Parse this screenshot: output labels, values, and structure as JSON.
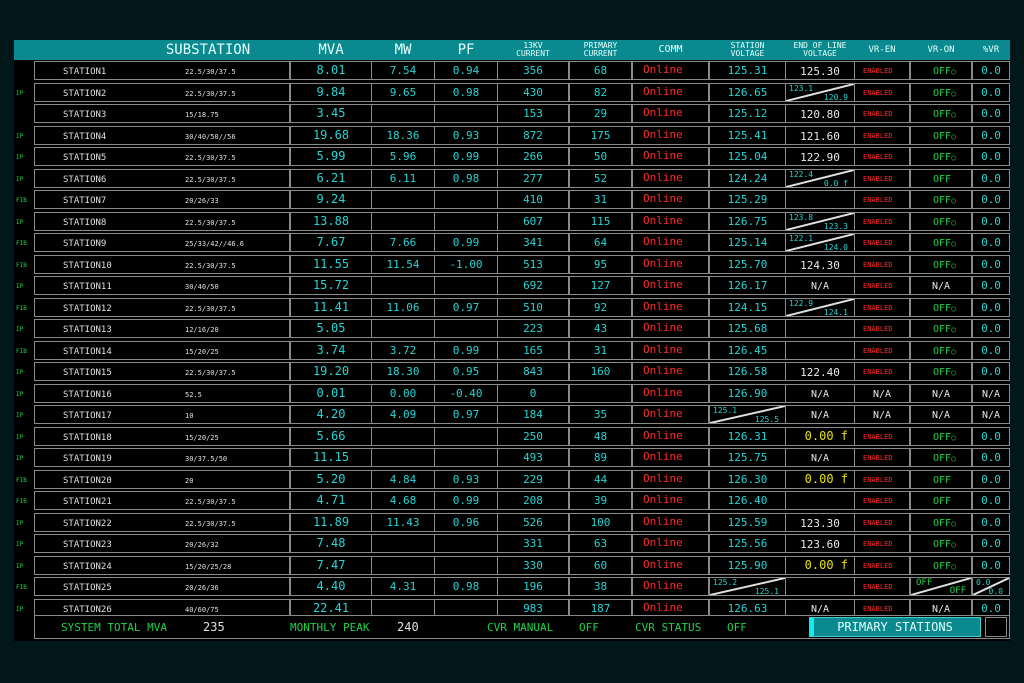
{
  "headers": {
    "substation": "SUBSTATION",
    "mva": "MVA",
    "mw": "MW",
    "pf": "PF",
    "kv_current": [
      "13KV",
      "CURRENT"
    ],
    "primary_current": [
      "PRIMARY",
      "CURRENT"
    ],
    "comm": "COMM",
    "station_voltage": [
      "STATION",
      "VOLTAGE"
    ],
    "eol_voltage": [
      "END OF LINE",
      "VOLTAGE"
    ],
    "vr_en": "VR-EN",
    "vr_on": "VR-ON",
    "pvr": "%VR"
  },
  "stations": [
    {
      "side": "",
      "name": "STATION1",
      "rating": "22.5/30/37.5",
      "mva": "8.01",
      "mw": "7.54",
      "pf": "0.94",
      "kv": "356",
      "pc": "68",
      "comm": "Online",
      "sv": {
        "v": "125.31"
      },
      "eol": {
        "v": "125.30"
      },
      "en": "ENABLED",
      "on": {
        "t": "OFF",
        "dot": true
      },
      "vr": "0.0"
    },
    {
      "side": "IP",
      "name": "STATION2",
      "rating": "22.5/30/37.5",
      "mva": "9.84",
      "mw": "9.65",
      "pf": "0.98",
      "kv": "430",
      "pc": "82",
      "comm": "Online",
      "sv": {
        "v": "126.65"
      },
      "eol": {
        "a": "123.1",
        "b": "120.9"
      },
      "en": "ENABLED",
      "on": {
        "t": "OFF",
        "dot": true
      },
      "vr": "0.0"
    },
    {
      "side": "",
      "name": "STATION3",
      "rating": "15/18.75",
      "mva": "3.45",
      "mw": "",
      "pf": "",
      "kv": "153",
      "pc": "29",
      "comm": "Online",
      "sv": {
        "v": "125.12"
      },
      "eol": {
        "v": "120.80"
      },
      "en": "ENABLED",
      "on": {
        "t": "OFF",
        "dot": true
      },
      "vr": "0.0"
    },
    {
      "side": "IP",
      "name": "STATION4",
      "rating": "30/40/50//56",
      "mva": "19.68",
      "mw": "18.36",
      "pf": "0.93",
      "kv": "872",
      "pc": "175",
      "comm": "Online",
      "sv": {
        "v": "125.41"
      },
      "eol": {
        "v": "121.60"
      },
      "en": "ENABLED",
      "on": {
        "t": "OFF",
        "dot": true
      },
      "vr": "0.0"
    },
    {
      "side": "IP",
      "name": "STATION5",
      "rating": "22.5/30/37.5",
      "mva": "5.99",
      "mw": "5.96",
      "pf": "0.99",
      "kv": "266",
      "pc": "50",
      "comm": "Online",
      "sv": {
        "v": "125.04"
      },
      "eol": {
        "v": "122.90"
      },
      "en": "ENABLED",
      "on": {
        "t": "OFF",
        "dot": true
      },
      "vr": "0.0"
    },
    {
      "side": "IP",
      "name": "STATION6",
      "rating": "22.5/30/37.5",
      "mva": "6.21",
      "mw": "6.11",
      "pf": "0.98",
      "kv": "277",
      "pc": "52",
      "comm": "Online",
      "sv": {
        "v": "124.24"
      },
      "eol": {
        "a": "122.4",
        "b": "0.0 f"
      },
      "en": "ENABLED",
      "on": {
        "t": "OFF",
        "dot": false
      },
      "vr": "0.0"
    },
    {
      "side": "FIB",
      "name": "STATION7",
      "rating": "20/26/33",
      "mva": "9.24",
      "mw": "",
      "pf": "",
      "kv": "410",
      "pc": "31",
      "comm": "Online",
      "sv": {
        "v": "125.29"
      },
      "eol": {},
      "en": "ENABLED",
      "on": {
        "t": "OFF",
        "dot": true
      },
      "vr": "0.0"
    },
    {
      "side": "IP",
      "name": "STATION8",
      "rating": "22.5/30/37.5",
      "mva": "13.88",
      "mw": "",
      "pf": "",
      "kv": "607",
      "pc": "115",
      "comm": "Online",
      "sv": {
        "v": "126.75"
      },
      "eol": {
        "a": "123.8",
        "b": "123.3"
      },
      "en": "ENABLED",
      "on": {
        "t": "OFF",
        "dot": true
      },
      "vr": "0.0"
    },
    {
      "side": "FIB",
      "name": "STATION9",
      "rating": "25/33/42//46.6",
      "mva": "7.67",
      "mw": "7.66",
      "pf": "0.99",
      "kv": "341",
      "pc": "64",
      "comm": "Online",
      "sv": {
        "v": "125.14"
      },
      "eol": {
        "a": "122.1",
        "b": "124.0"
      },
      "en": "ENABLED",
      "on": {
        "t": "OFF",
        "dot": true
      },
      "vr": "0.0"
    },
    {
      "side": "FIB",
      "name": "STATION10",
      "rating": "22.5/30/37.5",
      "mva": "11.55",
      "mw": "11.54",
      "pf": "-1.00",
      "kv": "513",
      "pc": "95",
      "comm": "Online",
      "sv": {
        "v": "125.70"
      },
      "eol": {
        "v": "124.30"
      },
      "en": "ENABLED",
      "on": {
        "t": "OFF",
        "dot": true
      },
      "vr": "0.0"
    },
    {
      "side": "IP",
      "name": "STATION11",
      "rating": "30/40/50",
      "mva": "15.72",
      "mw": "",
      "pf": "",
      "kv": "692",
      "pc": "127",
      "comm": "Online",
      "sv": {
        "v": "126.17"
      },
      "eol": {
        "na": "N/A"
      },
      "en": "ENABLED",
      "on": {
        "na": "N/A"
      },
      "vr": "0.0"
    },
    {
      "side": "FIB",
      "name": "STATION12",
      "rating": "22.5/30/37.5",
      "mva": "11.41",
      "mw": "11.06",
      "pf": "0.97",
      "kv": "510",
      "pc": "92",
      "comm": "Online",
      "sv": {
        "v": "124.15"
      },
      "eol": {
        "a": "122.9",
        "b": "124.1"
      },
      "en": "ENABLED",
      "on": {
        "t": "OFF",
        "dot": true
      },
      "vr": "0.0"
    },
    {
      "side": "IP",
      "name": "STATION13",
      "rating": "12/16/20",
      "mva": "5.05",
      "mw": "",
      "pf": "",
      "kv": "223",
      "pc": "43",
      "comm": "Online",
      "sv": {
        "v": "125.68"
      },
      "eol": {},
      "en": "ENABLED",
      "on": {
        "t": "OFF",
        "dot": true
      },
      "vr": "0.0"
    },
    {
      "side": "FIB",
      "name": "STATION14",
      "rating": "15/20/25",
      "mva": "3.74",
      "mw": "3.72",
      "pf": "0.99",
      "kv": "165",
      "pc": "31",
      "comm": "Online",
      "sv": {
        "v": "126.45"
      },
      "eol": {},
      "en": "ENABLED",
      "on": {
        "t": "OFF",
        "dot": true
      },
      "vr": "0.0"
    },
    {
      "side": "IP",
      "name": "STATION15",
      "rating": "22.5/30/37.5",
      "mva": "19.20",
      "mw": "18.30",
      "pf": "0.95",
      "kv": "843",
      "pc": "160",
      "comm": "Online",
      "sv": {
        "v": "126.58"
      },
      "eol": {
        "v": "122.40"
      },
      "en": "ENABLED",
      "on": {
        "t": "OFF",
        "dot": true
      },
      "vr": "0.0"
    },
    {
      "side": "IP",
      "name": "STATION16",
      "rating": "52.5",
      "mva": "0.01",
      "mw": "0.00",
      "pf": "-0.40",
      "kv": "0",
      "pc": "",
      "comm": "Online",
      "sv": {
        "v": "126.90"
      },
      "eol": {
        "na": "N/A"
      },
      "en_na": "N/A",
      "on": {
        "na": "N/A"
      },
      "vr_na": "N/A"
    },
    {
      "side": "IP",
      "name": "STATION17",
      "rating": "10",
      "mva": "4.20",
      "mw": "4.09",
      "pf": "0.97",
      "kv": "184",
      "pc": "35",
      "comm": "Online",
      "sv": {
        "a": "125.1",
        "b": "125.5"
      },
      "eol": {
        "na": "N/A"
      },
      "en_na": "N/A",
      "on": {
        "na": "N/A"
      },
      "vr_na": "N/A"
    },
    {
      "side": "IP",
      "name": "STATION18",
      "rating": "15/20/25",
      "mva": "5.66",
      "mw": "",
      "pf": "",
      "kv": "250",
      "pc": "48",
      "comm": "Online",
      "sv": {
        "v": "126.31"
      },
      "eol": {
        "y": "0.00 f"
      },
      "en": "ENABLED",
      "on": {
        "t": "OFF",
        "dot": true
      },
      "vr": "0.0"
    },
    {
      "side": "IP",
      "name": "STATION19",
      "rating": "30/37.5/50",
      "mva": "11.15",
      "mw": "",
      "pf": "",
      "kv": "493",
      "pc": "89",
      "comm": "Online",
      "sv": {
        "v": "125.75"
      },
      "eol": {
        "na": "N/A"
      },
      "en": "ENABLED",
      "on": {
        "t": "OFF",
        "dot": true
      },
      "vr": "0.0"
    },
    {
      "side": "FIB",
      "name": "STATION20",
      "rating": "20",
      "mva": "5.20",
      "mw": "4.84",
      "pf": "0.93",
      "kv": "229",
      "pc": "44",
      "comm": "Online",
      "sv": {
        "v": "126.30"
      },
      "eol": {
        "y": "0.00 f"
      },
      "en": "ENABLED",
      "on": {
        "t": "OFF",
        "dot": false
      },
      "vr": "0.0"
    },
    {
      "side": "FIB",
      "name": "STATION21",
      "rating": "22.5/30/37.5",
      "mva": "4.71",
      "mw": "4.68",
      "pf": "0.99",
      "kv": "208",
      "pc": "39",
      "comm": "Online",
      "sv": {
        "v": "126.40"
      },
      "eol": {},
      "en": "ENABLED",
      "on": {
        "t": "OFF",
        "dot": false
      },
      "vr": "0.0"
    },
    {
      "side": "IP",
      "name": "STATION22",
      "rating": "22.5/30/37.5",
      "mva": "11.89",
      "mw": "11.43",
      "pf": "0.96",
      "kv": "526",
      "pc": "100",
      "comm": "Online",
      "sv": {
        "v": "125.59"
      },
      "eol": {
        "v": "123.30"
      },
      "en": "ENABLED",
      "on": {
        "t": "OFF",
        "dot": true
      },
      "vr": "0.0"
    },
    {
      "side": "IP",
      "name": "STATION23",
      "rating": "20/26/32",
      "mva": "7.48",
      "mw": "",
      "pf": "",
      "kv": "331",
      "pc": "63",
      "comm": "Online",
      "sv": {
        "v": "125.56"
      },
      "eol": {
        "v": "123.60"
      },
      "en": "ENABLED",
      "on": {
        "t": "OFF",
        "dot": true
      },
      "vr": "0.0"
    },
    {
      "side": "IP",
      "name": "STATION24",
      "rating": "15/20/25/28",
      "mva": "7.47",
      "mw": "",
      "pf": "",
      "kv": "330",
      "pc": "60",
      "comm": "Online",
      "sv": {
        "v": "125.90"
      },
      "eol": {
        "y": "0.00 f"
      },
      "en": "ENABLED",
      "on": {
        "t": "OFF",
        "dot": true
      },
      "vr": "0.0"
    },
    {
      "side": "FIB",
      "name": "STATION25",
      "rating": "20/26/36",
      "mva": "4.40",
      "mw": "4.31",
      "pf": "0.98",
      "kv": "196",
      "pc": "38",
      "comm": "Online",
      "sv": {
        "a": "125.2",
        "b": "125.1"
      },
      "eol": {},
      "en": "ENABLED",
      "on": {
        "ga": "OFF",
        "gb": "OFF"
      },
      "vr_split": {
        "a": "0.0",
        "b": "0.0"
      }
    },
    {
      "side": "IP",
      "name": "STATION26",
      "rating": "40/60/75",
      "mva": "22.41",
      "mw": "",
      "pf": "",
      "kv": "983",
      "pc": "187",
      "comm": "Online",
      "sv": {
        "v": "126.63"
      },
      "eol": {
        "na": "N/A"
      },
      "en": "ENABLED",
      "on": {
        "na": "N/A"
      },
      "vr": "0.0"
    }
  ],
  "footer": {
    "total_label": "SYSTEM TOTAL MVA",
    "total_value": "235",
    "peak_label": "MONTHLY PEAK",
    "peak_value": "240",
    "cvr_manual_label": "CVR MANUAL",
    "cvr_manual_value": "OFF",
    "cvr_status_label": "CVR STATUS",
    "cvr_status_value": "OFF",
    "primary_button": "PRIMARY STATIONS"
  }
}
